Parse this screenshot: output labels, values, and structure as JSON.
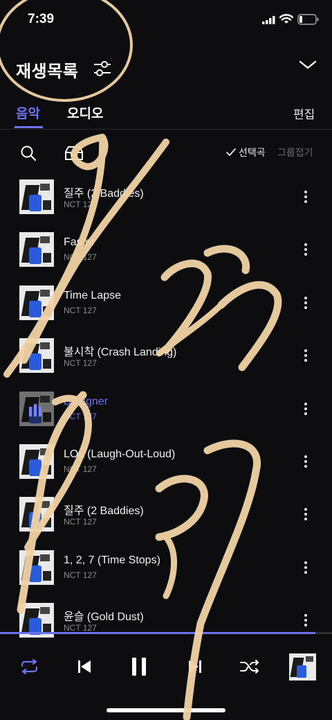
{
  "status_bar": {
    "time": "7:39"
  },
  "header": {
    "title": "재생목록",
    "filter_icon": "sliders-icon",
    "collapse_icon": "chevron-down-icon"
  },
  "tabs": [
    {
      "label": "음악",
      "active": true
    },
    {
      "label": "오디오",
      "active": false
    }
  ],
  "edit_label": "편집",
  "toolbar": {
    "search_icon": "search-icon",
    "archive_icon": "inbox-icon",
    "select_label": "선택곡",
    "group_label": "그룹접기"
  },
  "tracks": [
    {
      "title": "질주 (2 Baddies)",
      "artist": "NCT 127",
      "playing": false
    },
    {
      "title": "Faster",
      "artist": "NCT 127",
      "playing": false
    },
    {
      "title": "Time Lapse",
      "artist": "NCT 127",
      "playing": false
    },
    {
      "title": "불시착 (Crash Landing)",
      "artist": "NCT 127",
      "playing": false
    },
    {
      "title": "Designer",
      "artist": "NCT 127",
      "playing": true
    },
    {
      "title": "LOL (Laugh-Out-Loud)",
      "artist": "NCT 127",
      "playing": false
    },
    {
      "title": "질주 (2 Baddies)",
      "artist": "NCT 127",
      "playing": false
    },
    {
      "title": "1, 2, 7 (Time Stops)",
      "artist": "NCT 127",
      "playing": false
    },
    {
      "title": "윤슬 (Gold Dust)",
      "artist": "NCT 127",
      "playing": false
    }
  ],
  "player": {
    "progress": 0.95,
    "repeat_icon": "repeat-icon",
    "prev_icon": "previous-icon",
    "pause_icon": "pause-icon",
    "next_icon": "next-icon",
    "shuffle_icon": "shuffle-icon"
  },
  "colors": {
    "accent": "#6d74f5",
    "background": "#0d0c0e",
    "scribble": "#f1d3a4"
  }
}
